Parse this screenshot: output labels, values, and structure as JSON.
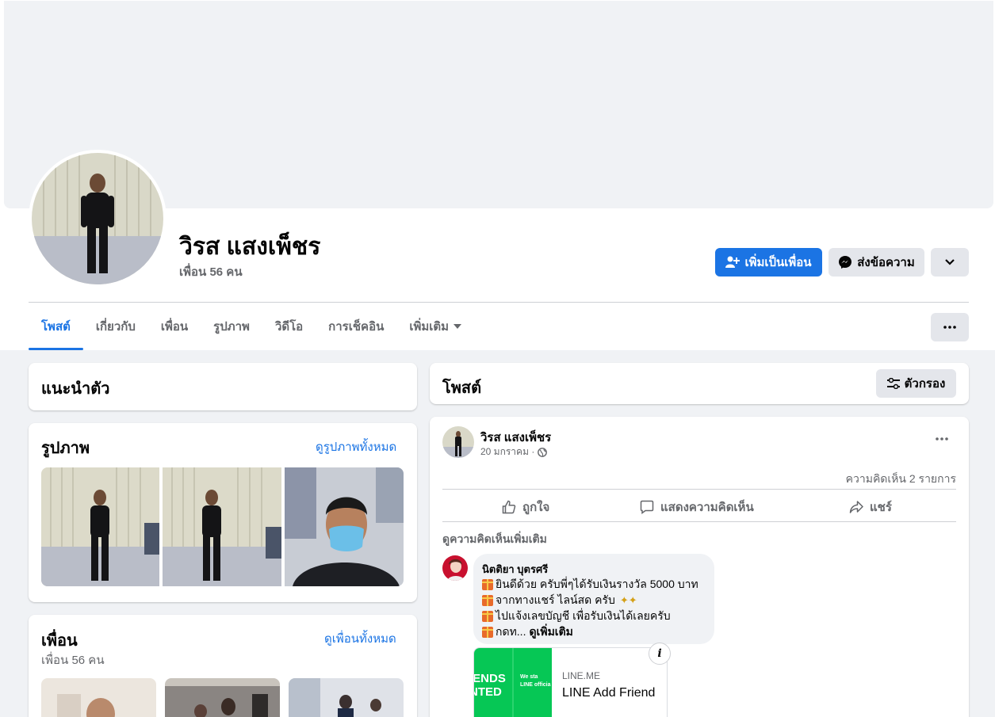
{
  "profile": {
    "name": "วิรส แสงเพ็ชร",
    "friend_count": "เพื่อน 56 คน"
  },
  "actions": {
    "add_friend": "เพิ่มเป็นเพื่อน",
    "message": "ส่งข้อความ"
  },
  "tabs": [
    {
      "label": "โพสต์",
      "active": true
    },
    {
      "label": "เกี่ยวกับ"
    },
    {
      "label": "เพื่อน"
    },
    {
      "label": "รูปภาพ"
    },
    {
      "label": "วิดีโอ"
    },
    {
      "label": "การเช็คอิน"
    },
    {
      "label": "เพิ่มเติม"
    }
  ],
  "intro": {
    "title": "แนะนำตัว"
  },
  "photos": {
    "title": "รูปภาพ",
    "see_all": "ดูรูปภาพทั้งหมด"
  },
  "friends": {
    "title": "เพื่อน",
    "count": "เพื่อน 56 คน",
    "see_all": "ดูเพื่อนทั้งหมด"
  },
  "posts_header": {
    "title": "โพสต์",
    "filter": "ตัวกรอง"
  },
  "post": {
    "author": "วิรส แสงเพ็ชร",
    "date": "20 มกราคม ·",
    "comments_count": "ความคิดเห็น 2 รายการ",
    "like": "ถูกใจ",
    "comment": "แสดงความคิดเห็น",
    "share": "แชร์",
    "more_comments": "ดูความคิดเห็นเพิ่มเติม"
  },
  "comment": {
    "author": "นิตติยา บุตรศรี",
    "lines": [
      "ยินดีด้วย ครับพี่ๆได้รับเงินรางวัล 5000 บาท",
      "จากทางแชร์ ไลน์สด ครับ",
      "ไปแจ้งเลขบัญชี เพื่อรับเงินได้เลยครับ",
      "กดท..."
    ],
    "see_more": "ดูเพิ่มเติม"
  },
  "link_preview": {
    "domain": "LINE.ME",
    "title": "LINE Add Friend",
    "thumb_text_1": "IENDS",
    "thumb_text_2": "NTED",
    "thumb_small_1": "We sta",
    "thumb_small_2": "LINE officia"
  },
  "colors": {
    "accent": "#1b74e4",
    "line_green": "#06c755",
    "page_bg": "#f0f2f5"
  }
}
